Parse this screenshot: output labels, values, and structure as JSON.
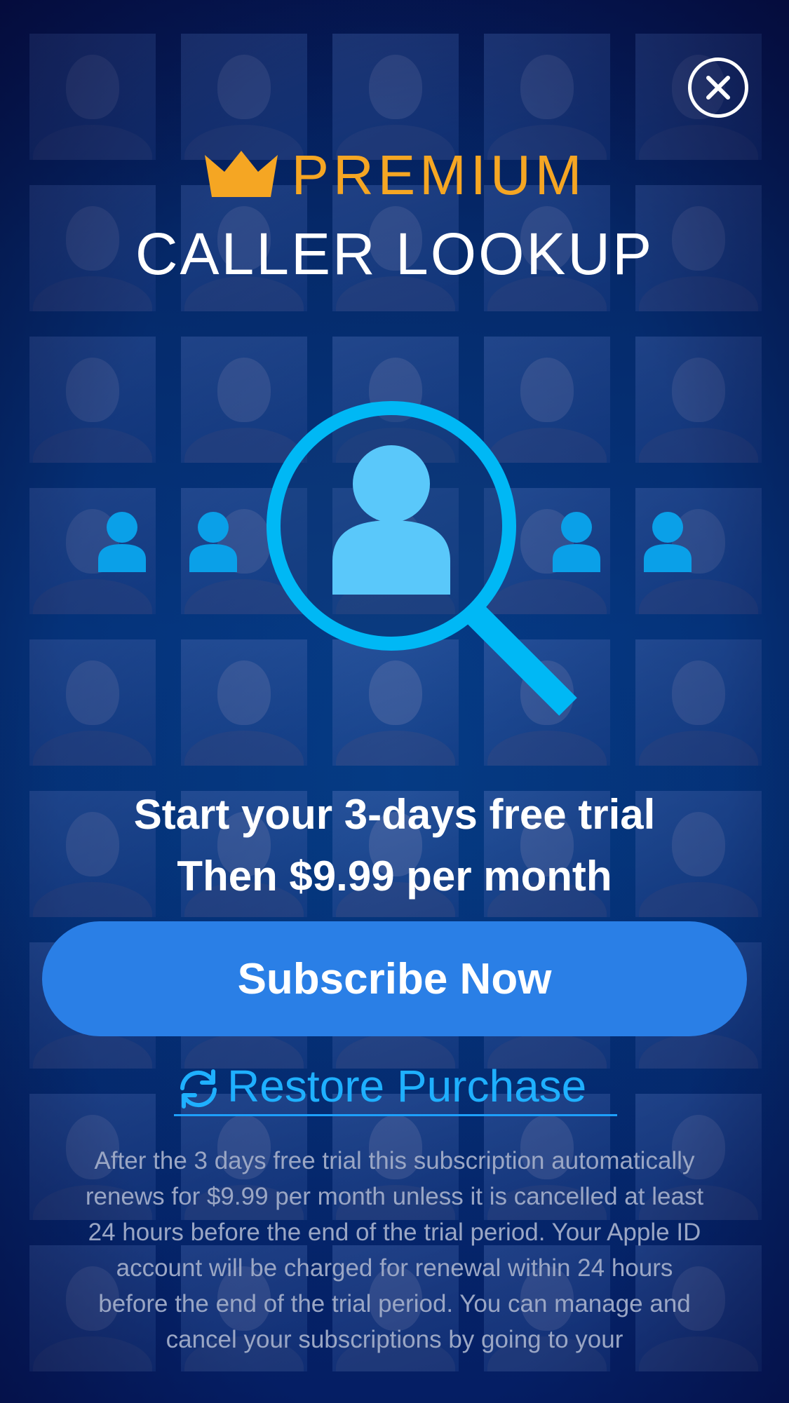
{
  "header": {
    "badge": "PREMIUM",
    "title": "CALLER LOOKUP"
  },
  "offer": {
    "line1": "Start your 3-days free trial",
    "line2": "Then $9.99 per month"
  },
  "actions": {
    "subscribe_label": "Subscribe Now",
    "restore_label": "Restore Purchase"
  },
  "terms": {
    "text": "After the 3 days free trial this subscription automatically renews for $9.99 per month unless it is cancelled at least 24 hours before the end of the trial period. Your Apple ID account will be charged for renewal within 24 hours before the end of the trial period. You can manage and cancel your subscriptions by going to your"
  },
  "icons": {
    "close": "close-icon",
    "crown": "crown-icon",
    "magnifier": "magnifier-person-icon",
    "restore": "refresh-icon",
    "person": "person-icon"
  },
  "colors": {
    "premium": "#f5a623",
    "accent_blue": "#00b8f5",
    "button": "#2a7fe6",
    "restore_link": "#1fb0ff",
    "background": "#052a63"
  }
}
